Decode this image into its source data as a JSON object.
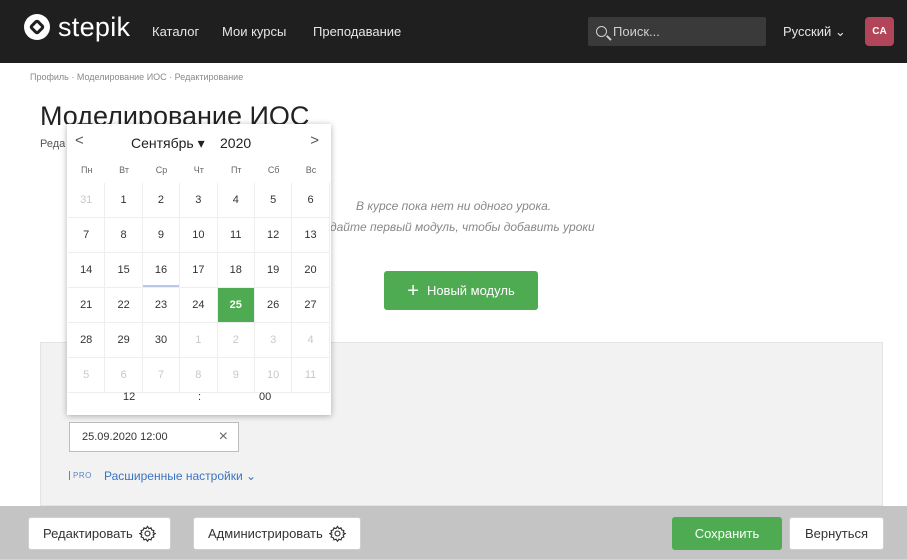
{
  "nav": {
    "brand": "stepik",
    "links": [
      "Каталог",
      "Мои курсы",
      "Преподавание"
    ],
    "search_placeholder": "Поиск...",
    "language": "Русский ⌄",
    "avatar_initials": "CA"
  },
  "breadcrumb": "Профиль · Моделирование ИОС · Редактирование",
  "page_title": "Моделирование ИОС",
  "subtext": "Реда",
  "empty_state": {
    "line1": "В курсе пока нет ни одного урока.",
    "line2": "дайте первый модуль, чтобы добавить уроки"
  },
  "new_module_button": {
    "icon": "+",
    "label": "Новый модуль"
  },
  "calendar": {
    "prev": "<",
    "next": ">",
    "month": "Сентябрь ▾",
    "year": "2020",
    "weekdays": [
      "Пн",
      "Вт",
      "Ср",
      "Чт",
      "Пт",
      "Сб",
      "Вс"
    ],
    "days": [
      {
        "d": "31",
        "o": true
      },
      {
        "d": "1"
      },
      {
        "d": "2"
      },
      {
        "d": "3"
      },
      {
        "d": "4"
      },
      {
        "d": "5"
      },
      {
        "d": "6"
      },
      {
        "d": "7"
      },
      {
        "d": "8"
      },
      {
        "d": "9"
      },
      {
        "d": "10"
      },
      {
        "d": "11"
      },
      {
        "d": "12"
      },
      {
        "d": "13"
      },
      {
        "d": "14"
      },
      {
        "d": "15"
      },
      {
        "d": "16",
        "today": true
      },
      {
        "d": "17"
      },
      {
        "d": "18"
      },
      {
        "d": "19"
      },
      {
        "d": "20"
      },
      {
        "d": "21"
      },
      {
        "d": "22"
      },
      {
        "d": "23"
      },
      {
        "d": "24"
      },
      {
        "d": "25",
        "selected": true
      },
      {
        "d": "26"
      },
      {
        "d": "27"
      },
      {
        "d": "28"
      },
      {
        "d": "29"
      },
      {
        "d": "30"
      },
      {
        "d": "1",
        "o": true
      },
      {
        "d": "2",
        "o": true
      },
      {
        "d": "3",
        "o": true
      },
      {
        "d": "4",
        "o": true
      },
      {
        "d": "5",
        "o": true
      },
      {
        "d": "6",
        "o": true
      },
      {
        "d": "7",
        "o": true
      },
      {
        "d": "8",
        "o": true
      },
      {
        "d": "9",
        "o": true
      },
      {
        "d": "10",
        "o": true
      },
      {
        "d": "11",
        "o": true
      }
    ],
    "time": {
      "hours": "12",
      "separator": ":",
      "minutes": "00"
    }
  },
  "date_field": {
    "value": "25.09.2020 12:00",
    "clear": "×"
  },
  "advanced": {
    "badge": "PRO",
    "label": "Расширенные настройки ⌄"
  },
  "toolbar": {
    "edit": "Редактировать",
    "admin": "Администрировать",
    "save": "Сохранить",
    "back": "Вернуться"
  },
  "colors": {
    "accent_green": "#4eab52",
    "topbar": "#1f1f1f",
    "avatar": "#b2455a",
    "link_blue": "#3b73c4"
  }
}
